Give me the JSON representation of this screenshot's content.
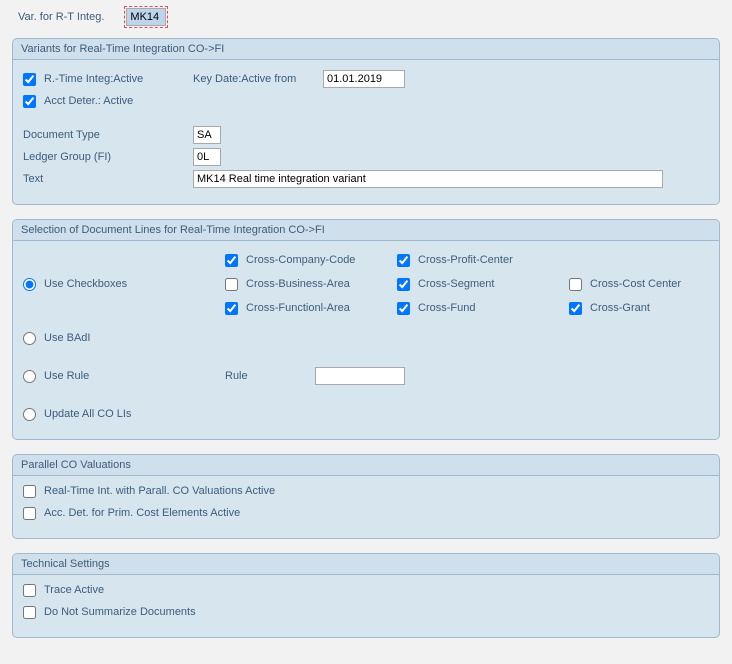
{
  "header": {
    "var_label": "Var. for R-T Integ.",
    "var_value": "MK14"
  },
  "variants": {
    "title": "Variants for Real-Time Integration CO->FI",
    "rt_active_label": "R.-Time Integ:Active",
    "key_date_label": "Key Date:Active from",
    "key_date_value": "01.01.2019",
    "acct_deter_label": "Acct Deter.: Active",
    "doc_type_label": "Document Type",
    "doc_type_value": "SA",
    "ledger_group_label": "Ledger Group (FI)",
    "ledger_group_value": "0L",
    "text_label": "Text",
    "text_value": "MK14 Real time integration variant"
  },
  "selection": {
    "title": "Selection of Document Lines for Real-Time Integration CO->FI",
    "use_checkboxes": "Use Checkboxes",
    "use_badi": "Use BAdI",
    "use_rule": "Use Rule",
    "rule_label": "Rule",
    "update_all": "Update All CO LIs",
    "cross_company": "Cross-Company-Code",
    "cross_business": "Cross-Business-Area",
    "cross_functional": "Cross-Functionl-Area",
    "cross_profit": "Cross-Profit-Center",
    "cross_segment": "Cross-Segment",
    "cross_fund": "Cross-Fund",
    "cross_cost": "Cross-Cost Center",
    "cross_grant": "Cross-Grant"
  },
  "parallel": {
    "title": "Parallel CO Valuations",
    "rt_parallel": "Real-Time Int. with Parall. CO Valuations Active",
    "acc_det": "Acc. Det. for Prim. Cost Elements Active"
  },
  "technical": {
    "title": "Technical Settings",
    "trace": "Trace Active",
    "no_summarize": "Do Not Summarize Documents"
  }
}
